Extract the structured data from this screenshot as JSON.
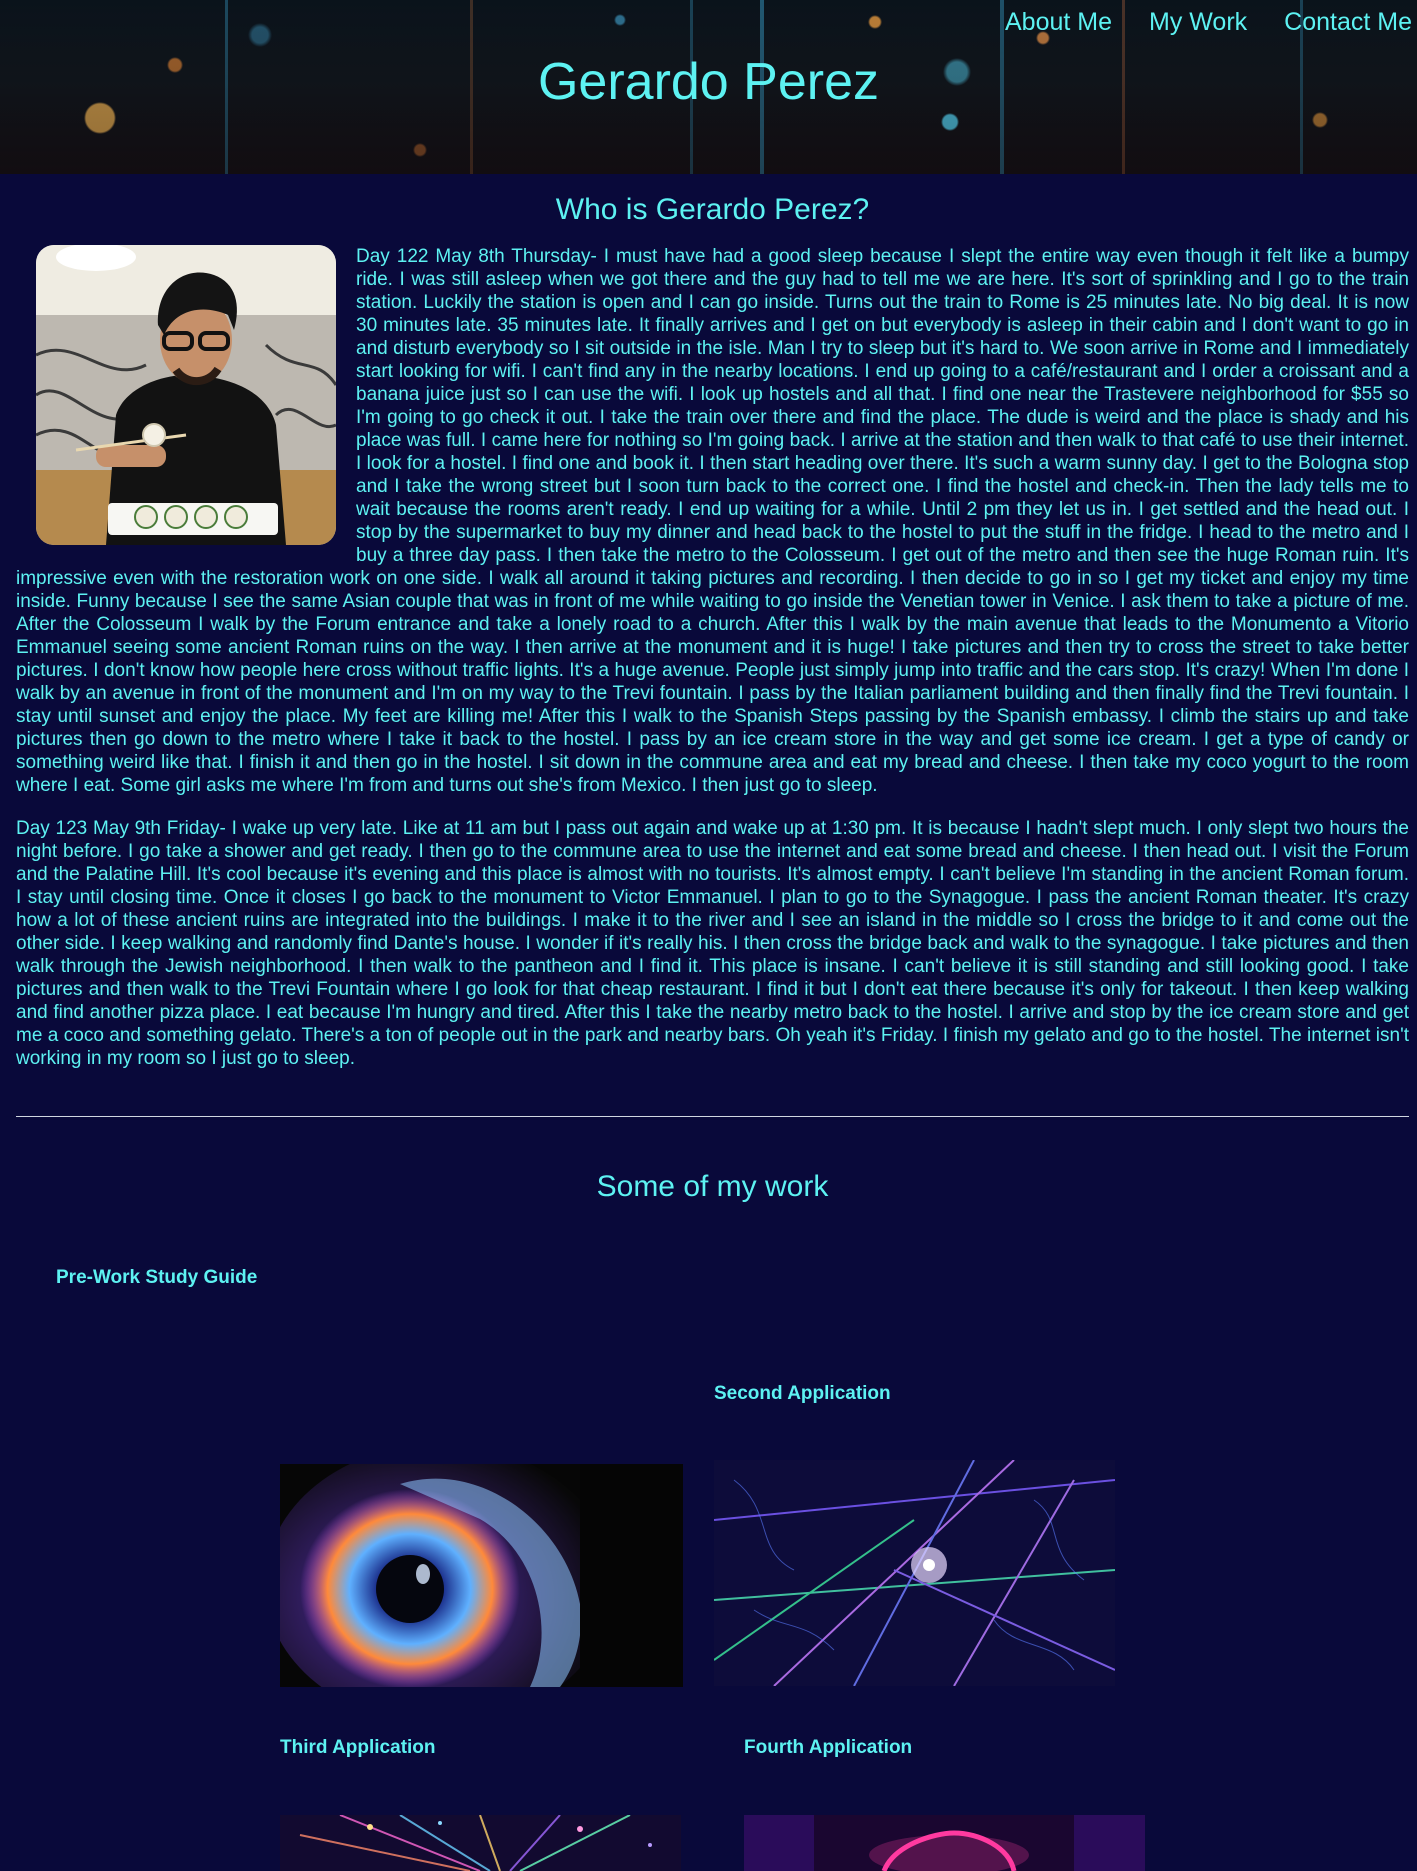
{
  "header": {
    "site_title": "Gerardo Perez",
    "nav": [
      {
        "label": "About Me"
      },
      {
        "label": "My Work"
      },
      {
        "label": "Contact Me"
      }
    ]
  },
  "about": {
    "heading": "Who is Gerardo Perez?",
    "paragraphs": [
      "Day 122 May 8th Thursday- I must have had a good sleep because I slept the entire way even though it felt like a bumpy ride. I was still asleep when we got there and the guy had to tell me we are here. It's sort of sprinkling and I go to the train station. Luckily the station is open and I can go inside. Turns out the train to Rome is 25 minutes late. No big deal. It is now 30 minutes late. 35 minutes late. It finally arrives and I get on but everybody is asleep in their cabin and I don't want to go in and disturb everybody so I sit outside in the isle. Man I try to sleep but it's hard to. We soon arrive in Rome and I immediately start looking for wifi. I can't find any in the nearby locations. I end up going to a café/restaurant and I order a croissant and a banana juice just so I can use the wifi. I look up hostels and all that. I find one near the Trastevere neighborhood for $55 so I'm going to go check it out. I take the train over there and find the place. The dude is weird and the place is shady and his place was full. I came here for nothing so I'm going back. I arrive at the station and then walk to that café to use their internet. I look for a hostel. I find one and book it. I then start heading over there. It's such a warm sunny day. I get to the Bologna stop and I take the wrong street but I soon turn back to the correct one. I find the hostel and check-in. Then the lady tells me to wait because the rooms aren't ready. I end up waiting for a while. Until 2 pm they let us in. I get settled and the head out. I stop by the supermarket to buy my dinner and head back to the hostel to put the stuff in the fridge. I head to the metro and I buy a three day pass. I then take the metro to the Colosseum. I get out of the metro and then see the huge Roman ruin. It's impressive even with the restoration work on one side. I walk all around it taking pictures and recording. I then decide to go in so I get my ticket and enjoy my time inside. Funny because I see the same Asian couple that was in front of me while waiting to go inside the Venetian tower in Venice. I ask them to take a picture of me. After the Colosseum I walk by the Forum entrance and take a lonely road to a church. After this I walk by the main avenue that leads to the Monumento a Vitorio Emmanuel seeing some ancient Roman ruins on the way. I then arrive at the monument and it is huge! I take pictures and then try to cross the street to take better pictures. I don't know how people here cross without traffic lights. It's a huge avenue. People just simply jump into traffic and the cars stop. It's crazy! When I'm done I walk by an avenue in front of the monument and I'm on my way to the Trevi fountain. I pass by the Italian parliament building and then finally find the Trevi fountain. I stay until sunset and enjoy the place. My feet are killing me! After this I walk to the Spanish Steps passing by the Spanish embassy. I climb the stairs up and take pictures then go down to the metro where I take it back to the hostel. I pass by an ice cream store in the way and get some ice cream. I get a type of candy or something weird like that. I finish it and then go in the hostel. I sit down in the commune area and eat my bread and cheese. I then take my coco yogurt to the room where I eat. Some girl asks me where I'm from and turns out she's from Mexico. I then just go to sleep.",
      "Day 123 May 9th Friday- I wake up very late. Like at 11 am but I pass out again and wake up at 1:30 pm. It is because I hadn't slept much. I only slept two hours the night before. I go take a shower and get ready. I then go to the commune area to use the internet and eat some bread and cheese. I then head out. I visit the Forum and the Palatine Hill. It's cool because it's evening and this place is almost with no tourists. It's almost empty. I can't believe I'm standing in the ancient Roman forum. I stay until closing time. Once it closes I go back to the monument to Victor Emmanuel. I plan to go to the Synagogue. I pass the ancient Roman theater. It's crazy how a lot of these ancient ruins are integrated into the buildings. I make it to the river and I see an island in the middle so I cross the bridge to it and come out the other side. I keep walking and randomly find Dante's house. I wonder if it's really his. I then cross the bridge back and walk to the synagogue. I take pictures and then walk through the Jewish neighborhood. I then walk to the pantheon and I find it. This place is insane. I can't believe it is still standing and still looking good. I take pictures and then walk to the Trevi Fountain where I go look for that cheap restaurant. I find it but I don't eat there because it's only for takeout. I then keep walking and find another pizza place. I eat because I'm hungry and tired. After this I take the nearby metro back to the hostel. I arrive and stop by the ice cream store and get me a coco and something gelato. There's a ton of people out in the park and nearby bars. Oh yeah it's Friday. I finish my gelato and go to the hostel. The internet isn't working in my room so I just go to sleep."
    ]
  },
  "work": {
    "heading": "Some of my work",
    "projects": [
      {
        "title": "Pre-Work Study Guide"
      },
      {
        "title": "Second Application"
      },
      {
        "title": "Third Application"
      },
      {
        "title": "Fourth Application"
      }
    ]
  },
  "colors": {
    "background": "#09093a",
    "accent_text": "#5df2f2"
  }
}
